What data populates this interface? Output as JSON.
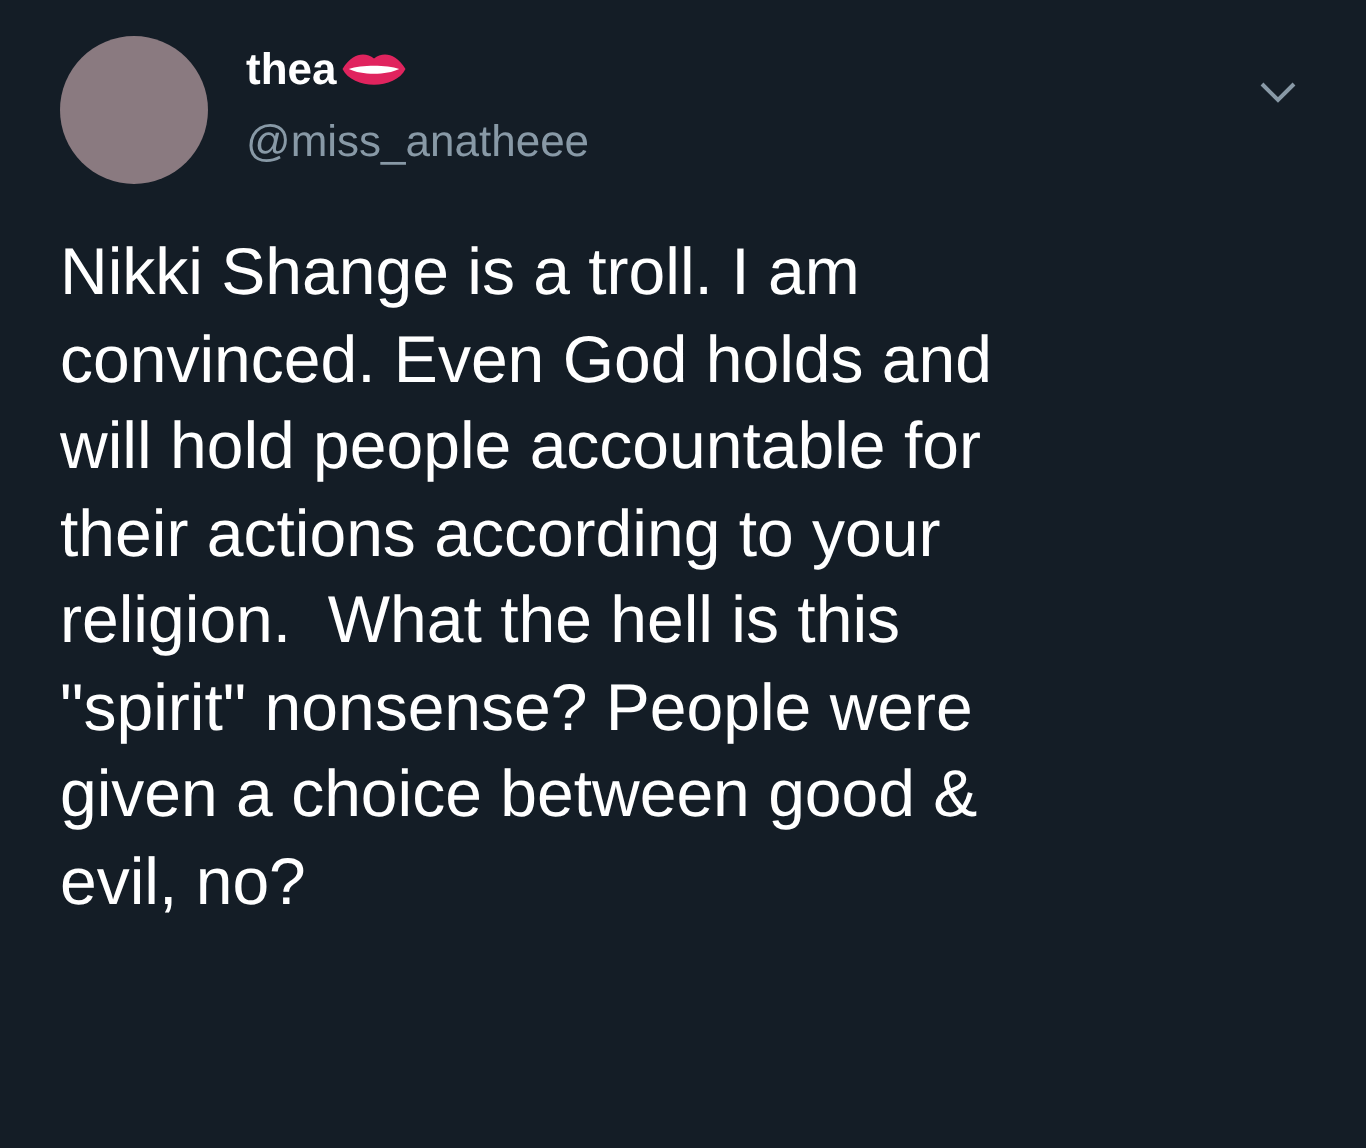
{
  "tweet": {
    "display_name": "thea",
    "handle": "@miss_anatheee",
    "text": "Nikki Shange is a troll. I am\nconvinced. Even God holds and\nwill hold people accountable for\ntheir actions according to your\nreligion.  What the hell is this\n\"spirit\" nonsense? People were\ngiven a choice between good &\nevil, no?"
  }
}
